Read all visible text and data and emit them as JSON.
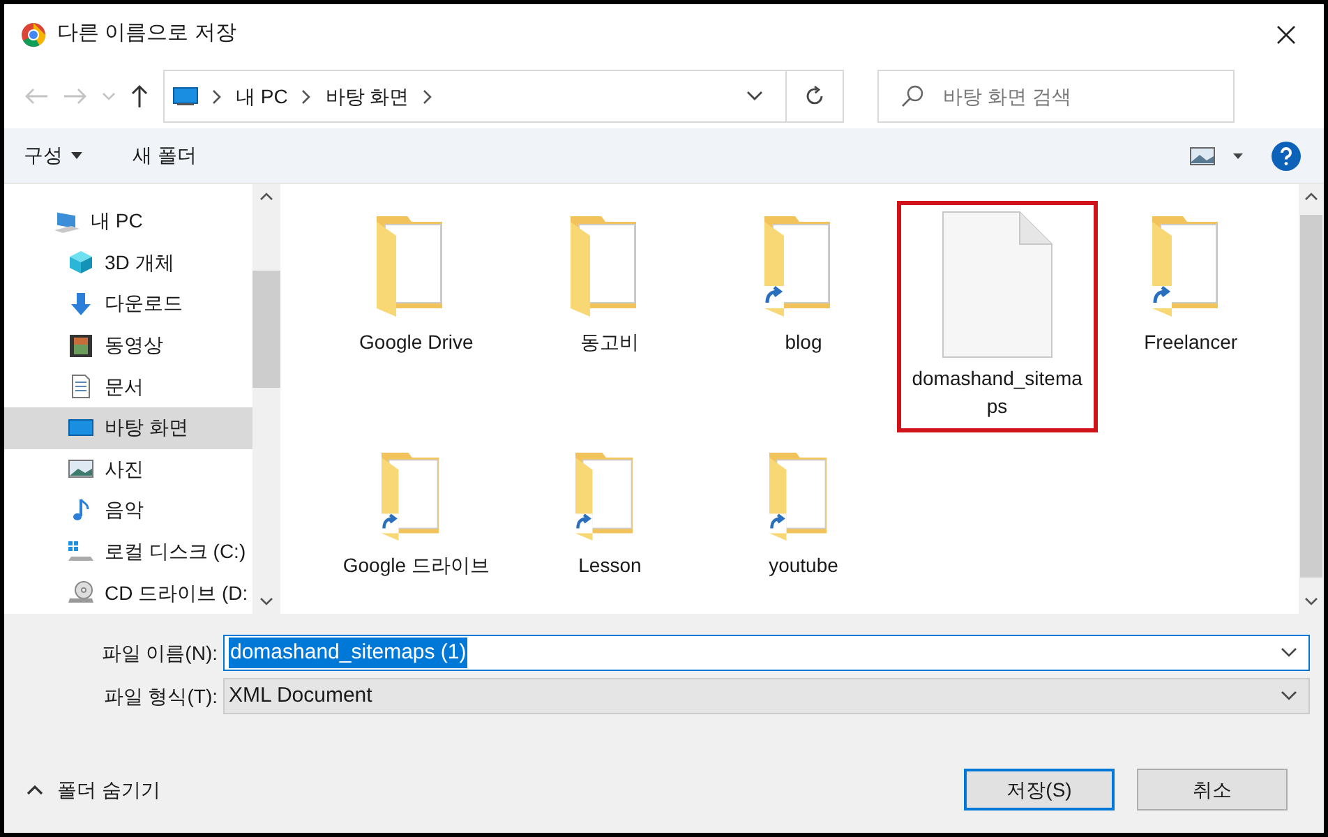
{
  "window": {
    "title": "다른 이름으로 저장"
  },
  "address": {
    "crumbs": [
      "내 PC",
      "바탕 화면"
    ]
  },
  "search": {
    "placeholder": "바탕 화면 검색"
  },
  "toolbar": {
    "organize": "구성",
    "new_folder": "새 폴더"
  },
  "sidebar": {
    "items": [
      {
        "label": "내 PC",
        "kind": "pc",
        "selected": false
      },
      {
        "label": "3D 개체",
        "kind": "cube",
        "selected": false
      },
      {
        "label": "다운로드",
        "kind": "download",
        "selected": false
      },
      {
        "label": "동영상",
        "kind": "video",
        "selected": false
      },
      {
        "label": "문서",
        "kind": "doc",
        "selected": false
      },
      {
        "label": "바탕 화면",
        "kind": "desktop",
        "selected": true
      },
      {
        "label": "사진",
        "kind": "photo",
        "selected": false
      },
      {
        "label": "음악",
        "kind": "music",
        "selected": false
      },
      {
        "label": "로컬 디스크 (C:)",
        "kind": "disk",
        "selected": false
      },
      {
        "label": "CD 드라이브 (D:",
        "kind": "cd",
        "selected": false
      }
    ]
  },
  "files": [
    {
      "name": "Google Drive",
      "kind": "folder",
      "shortcut": false,
      "highlighted": false
    },
    {
      "name": "동고비",
      "kind": "folder",
      "shortcut": false,
      "highlighted": false
    },
    {
      "name": "blog",
      "kind": "folder",
      "shortcut": true,
      "highlighted": false
    },
    {
      "name": "domashand_sitemaps",
      "kind": "file",
      "shortcut": false,
      "highlighted": true
    },
    {
      "name": "Freelancer",
      "kind": "folder",
      "shortcut": true,
      "highlighted": false
    },
    {
      "name": "Google 드라이브",
      "kind": "folder",
      "shortcut": true,
      "highlighted": false
    },
    {
      "name": "Lesson",
      "kind": "folder",
      "shortcut": true,
      "highlighted": false
    },
    {
      "name": "youtube",
      "kind": "folder",
      "shortcut": true,
      "highlighted": false
    }
  ],
  "form": {
    "filename_label": "파일 이름(N):",
    "filename": "domashand_sitemaps (1)",
    "type_label": "파일 형식(T):",
    "type": "XML Document"
  },
  "footer": {
    "hide_folders": "폴더 숨기기",
    "save": "저장(S)",
    "cancel": "취소"
  }
}
